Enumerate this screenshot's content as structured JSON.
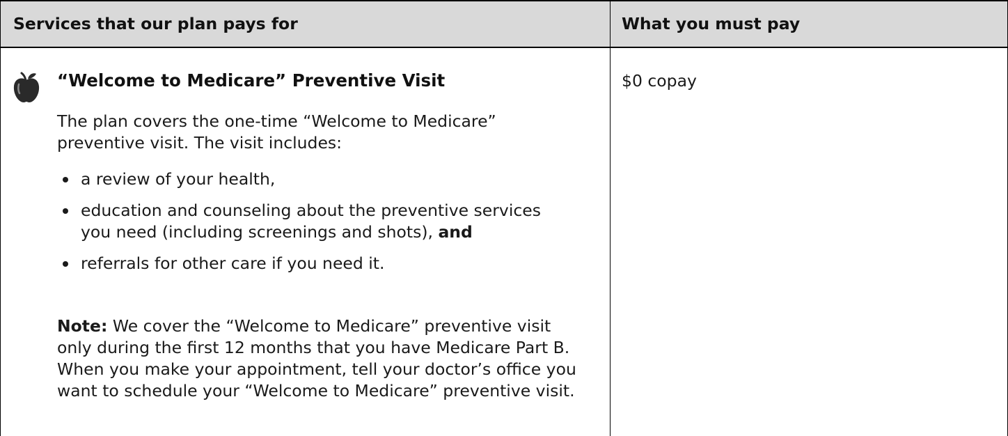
{
  "header": {
    "left": "Services that our plan pays for",
    "right": "What you must pay"
  },
  "service": {
    "icon": "apple-icon",
    "title": "“Welcome to Medicare” Preventive Visit",
    "intro": "The plan covers the one-time “Welcome to Medicare” preventive visit. The visit includes:",
    "bullets": [
      {
        "text": "a review of your health,"
      },
      {
        "text": "education and counseling about the preventive services you need (including screenings and shots), ",
        "bold_suffix": "and"
      },
      {
        "text": "referrals for other care if you need it."
      }
    ],
    "note_label": "Note:",
    "note_text": " We cover the “Welcome to Medicare” preventive visit only during the first 12 months that you have Medicare Part B. When you make your appointment, tell your doctor’s office you want to schedule your “Welcome to Medicare” preventive visit."
  },
  "cost": {
    "copay": "$0 copay"
  },
  "colors": {
    "header_bg": "#d9d9d9",
    "border": "#000000",
    "text": "#1a1a1a"
  }
}
